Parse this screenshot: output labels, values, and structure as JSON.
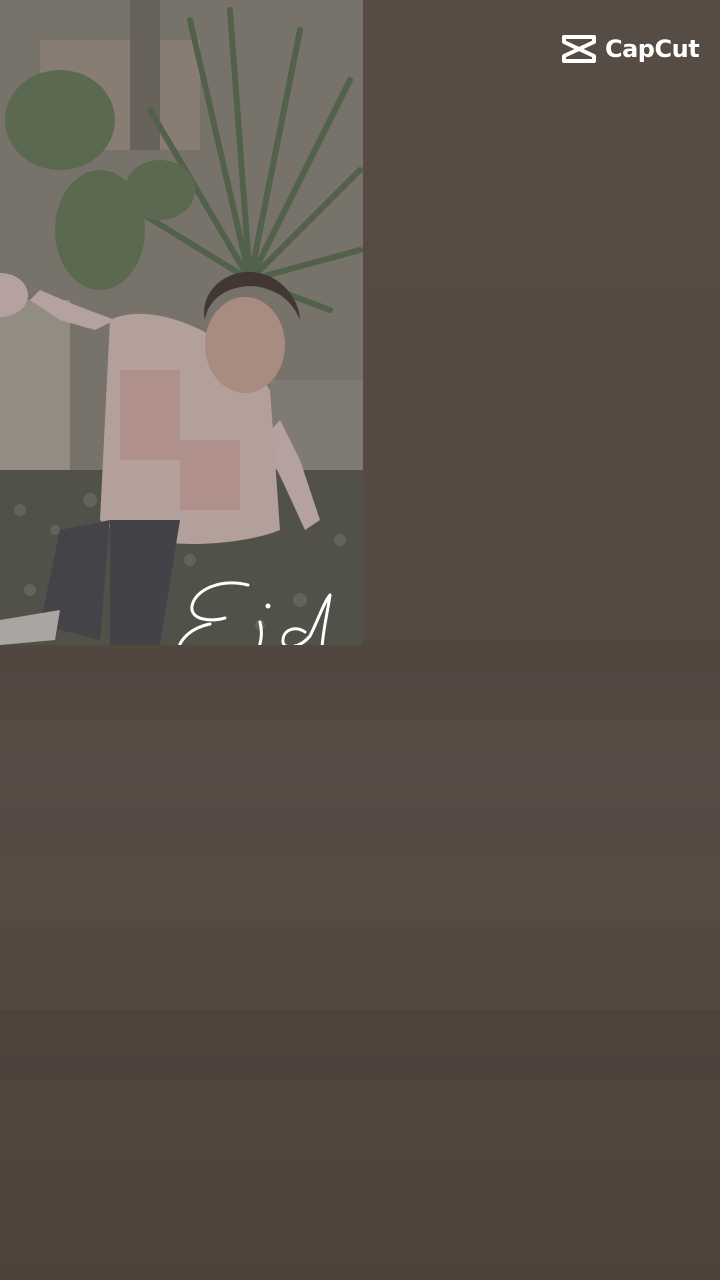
{
  "watermark": {
    "brand": "CapCut",
    "icon": "capcut-logo-icon"
  },
  "media": {
    "photo_icon": "child-photo",
    "script_caption": "Eid"
  },
  "colors": {
    "background_top": "#574c44",
    "background_bottom": "#4f423b",
    "watermark_text": "#ffffff"
  }
}
